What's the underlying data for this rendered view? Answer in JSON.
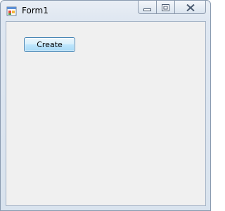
{
  "window": {
    "title": "Form1"
  },
  "titlebar": {
    "icon": "form-app-icon",
    "buttons": {
      "minimize_icon": "minimize-icon",
      "maximize_icon": "maximize-icon",
      "close_icon": "close-icon"
    }
  },
  "form": {
    "background": "#f0f0f0",
    "create_button": {
      "label": "Create"
    }
  },
  "colors": {
    "button_border": "#3c7fb1",
    "client_background": "#f0f0f0",
    "close_glyph": "#4a5a70"
  }
}
